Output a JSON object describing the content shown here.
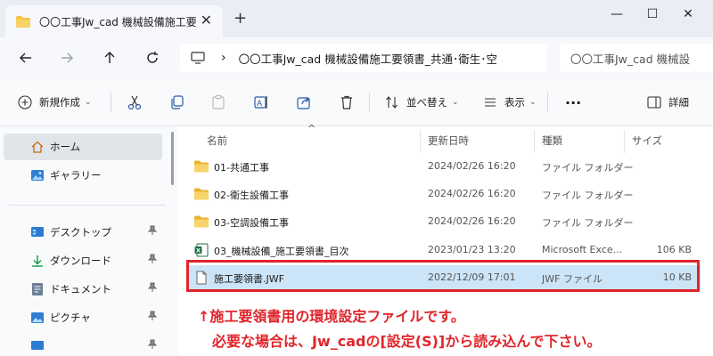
{
  "window": {
    "tab_title": "〇〇工事Jw_cad 機械設備施工要",
    "tab_close": "✕",
    "tab_add": "+",
    "minimize": "—",
    "maximize": "☐",
    "close": "✕"
  },
  "address": {
    "path": "〇〇工事Jw_cad 機械設備施工要領書_共通･衛生･空",
    "search": "〇〇工事Jw_cad 機械設"
  },
  "toolbar": {
    "new_label": "新規作成",
    "sort_label": "並べ替え",
    "view_label": "表示",
    "more_label": "···",
    "details_label": "詳細"
  },
  "sidebar": {
    "items": [
      {
        "label": "ホーム",
        "icon": "home-icon"
      },
      {
        "label": "ギャラリー",
        "icon": "gallery-icon"
      },
      {
        "label": "デスクトップ",
        "icon": "desktop-icon"
      },
      {
        "label": "ダウンロード",
        "icon": "download-icon"
      },
      {
        "label": "ドキュメント",
        "icon": "document-icon"
      },
      {
        "label": "ピクチャ",
        "icon": "picture-icon"
      }
    ],
    "pin": "📌"
  },
  "columns": {
    "sort_arrow": "^",
    "name": "名前",
    "date": "更新日時",
    "type": "種類",
    "size": "サイズ"
  },
  "files": [
    {
      "name": "01-共通工事",
      "date": "2024/02/26 16:20",
      "type": "ファイル フォルダー",
      "size": "",
      "icon": "folder-icon"
    },
    {
      "name": "02-衛生設備工事",
      "date": "2024/02/26 16:20",
      "type": "ファイル フォルダー",
      "size": "",
      "icon": "folder-icon"
    },
    {
      "name": "03-空調設備工事",
      "date": "2024/02/26 16:20",
      "type": "ファイル フォルダー",
      "size": "",
      "icon": "folder-icon"
    },
    {
      "name": "03_機械設備_施工要領書_目次",
      "date": "2023/01/23 13:20",
      "type": "Microsoft Exce...",
      "size": "106 KB",
      "icon": "excel-icon"
    },
    {
      "name": "施工要領書.JWF",
      "date": "2022/12/09 17:01",
      "type": "JWF ファイル",
      "size": "10 KB",
      "icon": "file-icon"
    }
  ],
  "annotation": {
    "line1": "↑施工要領書用の環境設定ファイルです。",
    "line2": "必要な場合は、Jw_cadの[設定(S)]から読み込んで下さい。"
  },
  "colors": {
    "accent_red": "#e0252b",
    "folder": "#f5c542",
    "selected_row": "#cce4f7"
  }
}
